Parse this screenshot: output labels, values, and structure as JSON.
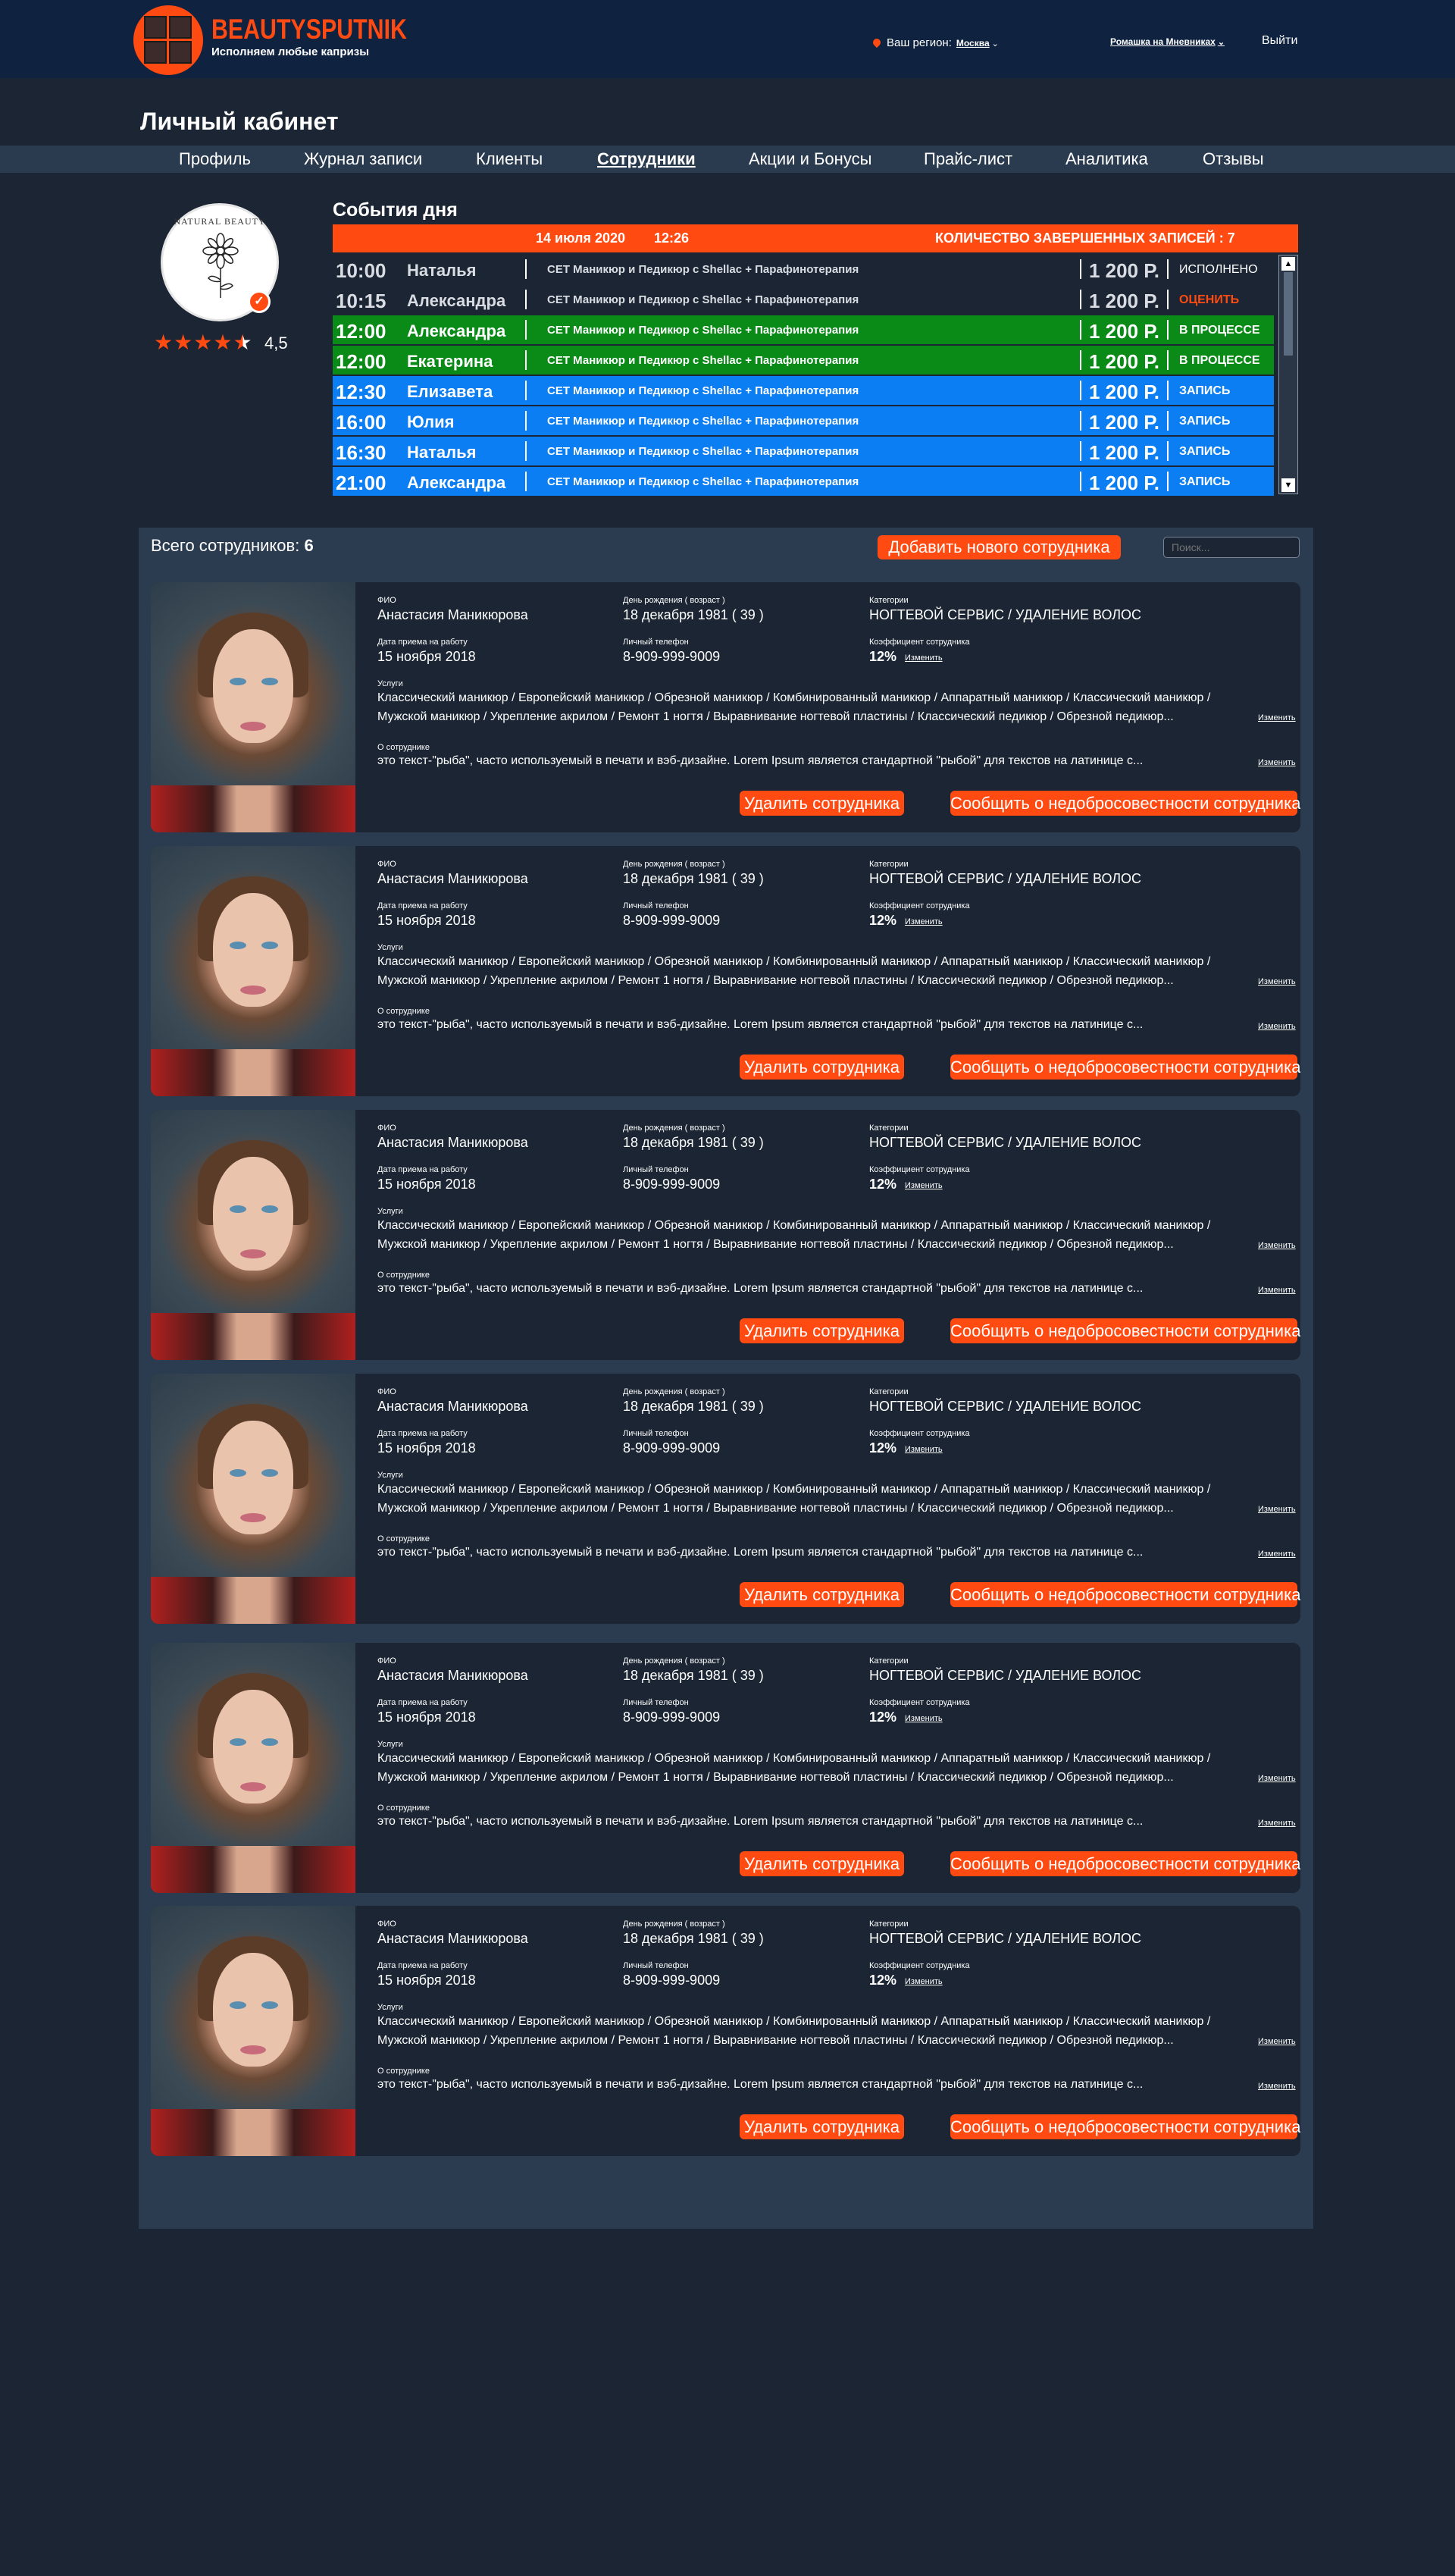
{
  "brand": {
    "name": "BEAUTYSPUTNIK",
    "tagline": "Исполняем любые капризы",
    "accent_color": "#ff4a12"
  },
  "header": {
    "region_label": "Ваш регион:",
    "region_value": "Москва",
    "salon": "Ромашка на Мневниках",
    "logout": "Выйти"
  },
  "page_title": "Личный кабинет",
  "nav": {
    "items": [
      "Профиль",
      "Журнал записи",
      "Клиенты",
      "Сотрудники",
      "Акции и Бонусы",
      "Прайс-лист",
      "Аналитика",
      "Отзывы"
    ],
    "active": "Сотрудники"
  },
  "profile": {
    "rating": 4.5,
    "rating_text": "4,5",
    "avatar_text": "NATURAL BEAUTY"
  },
  "events": {
    "title": "События дня",
    "date": "14 июля 2020",
    "time": "12:26",
    "completed": "КОЛИЧЕСТВО ЗАВЕРШЕННЫХ ЗАПИСЕЙ : 7",
    "rows": [
      {
        "time": "10:00",
        "name": "Наталья",
        "service": "СЕТ Маникюр и Педикюр с Shellac + Парафинотерапия",
        "price": "1 200 Р.",
        "status": "ИСПОЛНЕНО",
        "state": "done"
      },
      {
        "time": "10:15",
        "name": "Александра",
        "service": "СЕТ Маникюр и Педикюр с Shellac + Парафинотерапия",
        "price": "1 200 Р.",
        "status": "ОЦЕНИТЬ",
        "state": "rate"
      },
      {
        "time": "12:00",
        "name": "Александра",
        "service": "СЕТ Маникюр и Педикюр с Shellac + Парафинотерапия",
        "price": "1 200 Р.",
        "status": "В ПРОЦЕССЕ",
        "state": "progress"
      },
      {
        "time": "12:00",
        "name": "Екатерина",
        "service": "СЕТ Маникюр и Педикюр с Shellac + Парафинотерапия",
        "price": "1 200 Р.",
        "status": "В ПРОЦЕССЕ",
        "state": "progress"
      },
      {
        "time": "12:30",
        "name": "Елизавета",
        "service": "СЕТ Маникюр и Педикюр с Shellac + Парафинотерапия",
        "price": "1 200 Р.",
        "status": "ЗАПИСЬ",
        "state": "booked"
      },
      {
        "time": "16:00",
        "name": "Юлия",
        "service": "СЕТ Маникюр и Педикюр с Shellac + Парафинотерапия",
        "price": "1 200 Р.",
        "status": "ЗАПИСЬ",
        "state": "booked"
      },
      {
        "time": "16:30",
        "name": "Наталья",
        "service": "СЕТ Маникюр и Педикюр с Shellac + Парафинотерапия",
        "price": "1 200 Р.",
        "status": "ЗАПИСЬ",
        "state": "booked"
      },
      {
        "time": "21:00",
        "name": "Александра",
        "service": "СЕТ Маникюр и Педикюр с Shellac + Парафинотерапия",
        "price": "1 200 Р.",
        "status": "ЗАПИСЬ",
        "state": "booked"
      }
    ],
    "state_colors": {
      "done": "#1b2533",
      "rate": "#1b2533",
      "progress": "#0a8a17",
      "booked": "#0a7ef2",
      "rate_text": "#ff4a12"
    }
  },
  "staff": {
    "total_label": "Всего сотрудников:",
    "total": "6",
    "add_button": "Добавить нового сотрудника",
    "search_placeholder": "Поиск...",
    "labels": {
      "fio": "ФИО",
      "birthday": "День рождения ( возраст )",
      "category": "Категории",
      "hired": "Дата приема на работу",
      "phone": "Личный телефон",
      "coef": "Коэффициент сотрудника",
      "services": "Услуги",
      "about": "О сотруднике",
      "edit": "Изменить",
      "delete": "Удалить сотрудника",
      "report": "Сообщить о недобросовестности сотрудника"
    },
    "employees": [
      {
        "fio": "Анастасия Маникюрова",
        "birthday": "18 декабря 1981 ( 39 )",
        "category": "НОГТЕВОЙ СЕРВИС / УДАЛЕНИЕ ВОЛОС",
        "hired": "15 ноября 2018",
        "phone": "8-909-999-9009",
        "coef": "12%",
        "services_1": "Классический маникюр / Европейский маникюр / Обрезной маникюр / Комбинированный маникюр  / Аппаратный маникюр / Классический маникюр /",
        "services_2": "Мужской маникюр / Укрепление акрилом / Ремонт 1 ногтя / Выравнивание ногтевой пластины / Классический педикюр / Обрезной педикюр...",
        "about": "это текст-\"рыба\", часто используемый в печати и вэб-дизайне. Lorem Ipsum является стандартной \"рыбой\" для текстов на латинице с..."
      },
      {
        "fio": "Анастасия Маникюрова",
        "birthday": "18 декабря 1981 ( 39 )",
        "category": "НОГТЕВОЙ СЕРВИС / УДАЛЕНИЕ ВОЛОС",
        "hired": "15 ноября 2018",
        "phone": "8-909-999-9009",
        "coef": "12%",
        "services_1": "Классический маникюр / Европейский маникюр / Обрезной маникюр / Комбинированный маникюр  / Аппаратный маникюр / Классический маникюр /",
        "services_2": "Мужской маникюр / Укрепление акрилом / Ремонт 1 ногтя / Выравнивание ногтевой пластины / Классический педикюр / Обрезной педикюр...",
        "about": "это текст-\"рыба\", часто используемый в печати и вэб-дизайне. Lorem Ipsum является стандартной \"рыбой\" для текстов на латинице с..."
      },
      {
        "fio": "Анастасия Маникюрова",
        "birthday": "18 декабря 1981 ( 39 )",
        "category": "НОГТЕВОЙ СЕРВИС / УДАЛЕНИЕ ВОЛОС",
        "hired": "15 ноября 2018",
        "phone": "8-909-999-9009",
        "coef": "12%",
        "services_1": "Классический маникюр / Европейский маникюр / Обрезной маникюр / Комбинированный маникюр  / Аппаратный маникюр / Классический маникюр /",
        "services_2": "Мужской маникюр / Укрепление акрилом / Ремонт 1 ногтя / Выравнивание ногтевой пластины / Классический педикюр / Обрезной педикюр...",
        "about": "это текст-\"рыба\", часто используемый в печати и вэб-дизайне. Lorem Ipsum является стандартной \"рыбой\" для текстов на латинице с..."
      },
      {
        "fio": "Анастасия Маникюрова",
        "birthday": "18 декабря 1981 ( 39 )",
        "category": "НОГТЕВОЙ СЕРВИС / УДАЛЕНИЕ ВОЛОС",
        "hired": "15 ноября 2018",
        "phone": "8-909-999-9009",
        "coef": "12%",
        "services_1": "Классический маникюр / Европейский маникюр / Обрезной маникюр / Комбинированный маникюр  / Аппаратный маникюр / Классический маникюр /",
        "services_2": "Мужской маникюр / Укрепление акрилом / Ремонт 1 ногтя / Выравнивание ногтевой пластины / Классический педикюр / Обрезной педикюр...",
        "about": "это текст-\"рыба\", часто используемый в печати и вэб-дизайне. Lorem Ipsum является стандартной \"рыбой\" для текстов на латинице с..."
      },
      {
        "fio": "Анастасия Маникюрова",
        "birthday": "18 декабря 1981 ( 39 )",
        "category": "НОГТЕВОЙ СЕРВИС / УДАЛЕНИЕ ВОЛОС",
        "hired": "15 ноября 2018",
        "phone": "8-909-999-9009",
        "coef": "12%",
        "services_1": "Классический маникюр / Европейский маникюр / Обрезной маникюр / Комбинированный маникюр  / Аппаратный маникюр / Классический маникюр /",
        "services_2": "Мужской маникюр / Укрепление акрилом / Ремонт 1 ногтя / Выравнивание ногтевой пластины / Классический педикюр / Обрезной педикюр...",
        "about": "это текст-\"рыба\", часто используемый в печати и вэб-дизайне. Lorem Ipsum является стандартной \"рыбой\" для текстов на латинице с..."
      },
      {
        "fio": "Анастасия Маникюрова",
        "birthday": "18 декабря 1981 ( 39 )",
        "category": "НОГТЕВОЙ СЕРВИС / УДАЛЕНИЕ ВОЛОС",
        "hired": "15 ноября 2018",
        "phone": "8-909-999-9009",
        "coef": "12%",
        "services_1": "Классический маникюр / Европейский маникюр / Обрезной маникюр / Комбинированный маникюр  / Аппаратный маникюр / Классический маникюр /",
        "services_2": "Мужской маникюр / Укрепление акрилом / Ремонт 1 ногтя / Выравнивание ногтевой пластины / Классический педикюр / Обрезной педикюр...",
        "about": "это текст-\"рыба\", часто используемый в печати и вэб-дизайне. Lorem Ipsum является стандартной \"рыбой\" для текстов на латинице с..."
      }
    ]
  }
}
